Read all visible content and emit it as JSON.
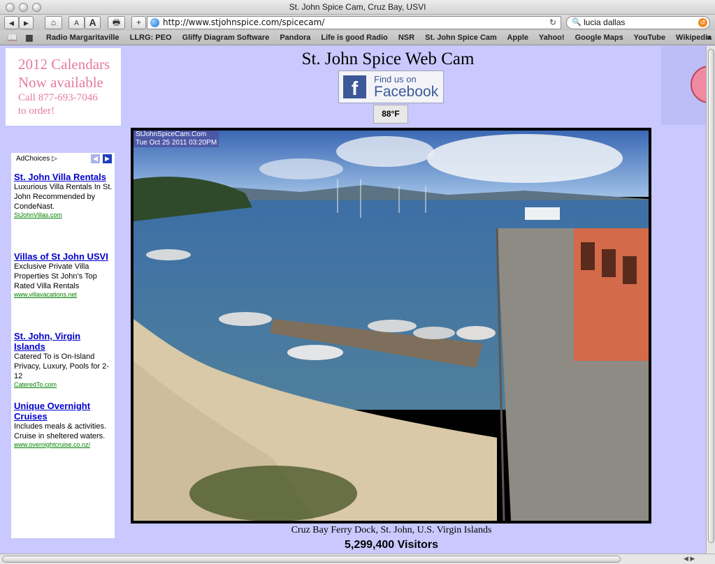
{
  "window": {
    "title": "St. John Spice Cam, Cruz Bay, USVI"
  },
  "toolbar": {
    "back_glyph": "◀",
    "forward_glyph": "▶",
    "home_glyph": "⌂",
    "text_smaller": "A",
    "text_bigger": "A",
    "print_glyph": "🖶",
    "add_glyph": "+",
    "url": "http://www.stjohnspice.com/spicecam/",
    "reload_glyph": "↻",
    "search_query": "lucia dallas"
  },
  "bookmarks": {
    "items": [
      "Radio Margaritaville",
      "LLRG: PEO",
      "Gliffy Diagram Software",
      "Pandora",
      "Life is good Radio",
      "NSR",
      "St. John Spice Cam",
      "Apple",
      "Yahoo!",
      "Google Maps",
      "YouTube",
      "Wikipedia"
    ],
    "more": "»"
  },
  "calendar_ad": {
    "line1": "2012 Calendars",
    "line2": "Now available",
    "line3": "Call 877-693-7046",
    "line4": "to order!"
  },
  "header": {
    "title": "St. John Spice Web Cam",
    "fb_small": "Find us on",
    "fb_big": "Facebook",
    "fb_logo": "f",
    "temperature": "88°F"
  },
  "ads": {
    "adchoices": "AdChoices ▷",
    "items": [
      {
        "title": "St. John Villa Rentals",
        "body": "Luxurious Villa Rentals In St. John Recommended by CondeNast.",
        "url": "StJohnVillas.com"
      },
      {
        "title": "Villas of St John USVI",
        "body": "Exclusive Private Villa Properties St John's Top Rated Villa Rentals",
        "url": "www.villavacations.net"
      },
      {
        "title": "St. John, Virgin Islands",
        "body": "Catered To is On-Island Privacy, Luxury, Pools for 2-12",
        "url": "CateredTo.com"
      },
      {
        "title": "Unique Overnight Cruises",
        "body": "Includes meals & activities. Cruise in sheltered waters.",
        "url": "www.overnightcruise.co.nz/"
      }
    ]
  },
  "webcam": {
    "stamp_line1": "StJohnSpiceCam.Com",
    "stamp_line2": "Tue Oct 25 2011 03:20PM",
    "caption": "Cruz Bay Ferry Dock, St. John, U.S. Virgin Islands",
    "visitors": "5,299,400 Visitors"
  },
  "colors": {
    "page_bg": "#c9c9ff",
    "calendar_pink": "#e67aa0",
    "ad_link": "#0000cc",
    "ad_url": "#008000",
    "facebook_blue": "#3b5998"
  }
}
